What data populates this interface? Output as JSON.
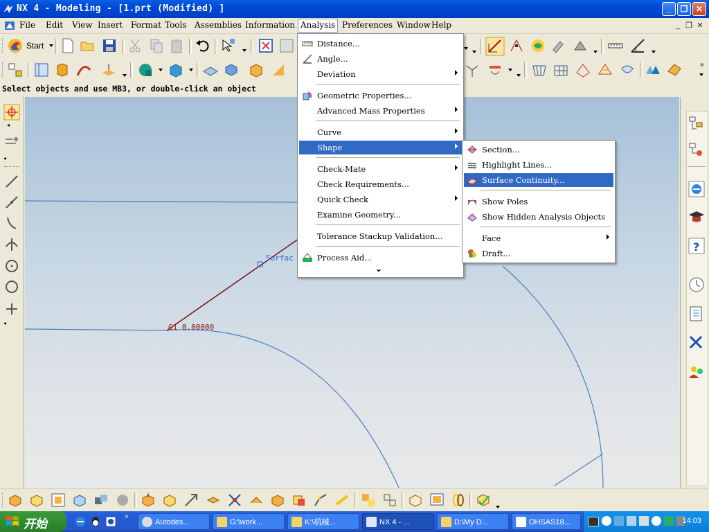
{
  "window": {
    "title": "NX 4 - Modeling - [1.prt (Modified) ]",
    "minimize": "_",
    "maximize": "❐",
    "close": "✕"
  },
  "menubar": {
    "items": [
      "File",
      "Edit",
      "View",
      "Insert",
      "Format",
      "Tools",
      "Assemblies",
      "Information",
      "Analysis",
      "Preferences",
      "Window",
      "Help"
    ],
    "active": "Analysis",
    "mdi": [
      "_",
      "❐",
      "✕"
    ]
  },
  "toolbar": {
    "start_label": "Start"
  },
  "status": "Select objects and use MB3, or double-click an object",
  "viewport": {
    "surface_label": "Surfac",
    "g1_label": "G1 0.00000"
  },
  "analysis_menu": {
    "items": [
      {
        "label": "Distance...",
        "icon": "ruler-icon"
      },
      {
        "label": "Angle...",
        "icon": "angle-icon"
      },
      {
        "label": "Deviation",
        "submenu": true
      },
      {
        "label": "Geometric Properties...",
        "icon": "geometry-icon"
      },
      {
        "label": "Advanced Mass Properties",
        "submenu": true
      },
      {
        "label": "Curve",
        "submenu": true
      },
      {
        "label": "Shape",
        "submenu": true,
        "highlighted": true
      },
      {
        "label": "Check-Mate",
        "submenu": true
      },
      {
        "label": "Check Requirements..."
      },
      {
        "label": "Quick Check",
        "submenu": true
      },
      {
        "label": "Examine Geometry..."
      },
      {
        "label": "Tolerance Stackup Validation..."
      },
      {
        "label": "Process Aid...",
        "icon": "process-icon"
      }
    ],
    "more": "⌄"
  },
  "shape_menu": {
    "items": [
      {
        "label": "Section...",
        "icon": "section-icon"
      },
      {
        "label": "Highlight Lines...",
        "icon": "highlight-lines-icon"
      },
      {
        "label": "Surface Continuity...",
        "icon": "surface-continuity-icon",
        "highlighted": true
      },
      {
        "label": "Show Poles",
        "icon": "poles-icon"
      },
      {
        "label": "Show Hidden Analysis Objects",
        "icon": "hidden-objects-icon"
      },
      {
        "label": "Face",
        "submenu": true
      },
      {
        "label": "Draft...",
        "icon": "draft-icon"
      }
    ]
  },
  "taskbar": {
    "start": "开始",
    "tasks": [
      "Autodes...",
      "G:\\work...",
      "K:\\机械...",
      "NX 4 - ...",
      "D:\\My D...",
      "OHSAS18..."
    ],
    "active_task": "NX 4 - ...",
    "clock": "14:03"
  }
}
